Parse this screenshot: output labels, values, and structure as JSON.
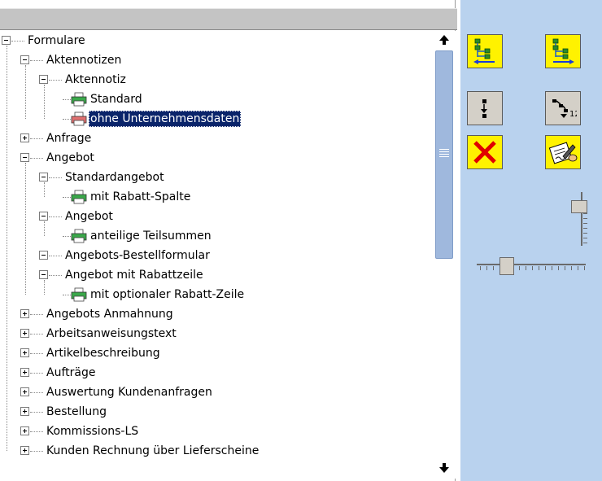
{
  "tree": {
    "rows": [
      {
        "label": "Formulare",
        "level": 0,
        "toggle": "minus",
        "icon": "none"
      },
      {
        "label": "Aktennotizen",
        "level": 1,
        "toggle": "minus",
        "icon": "none"
      },
      {
        "label": "Aktennotiz",
        "level": 2,
        "toggle": "minus",
        "icon": "none"
      },
      {
        "label": "Standard",
        "level": 3,
        "toggle": "none",
        "icon": "printer-green"
      },
      {
        "label": "ohne Unternehmensdaten",
        "level": 3,
        "toggle": "none",
        "icon": "printer-red",
        "selected": true
      },
      {
        "label": "Anfrage",
        "level": 1,
        "toggle": "plus",
        "icon": "none"
      },
      {
        "label": "Angebot",
        "level": 1,
        "toggle": "minus",
        "icon": "none"
      },
      {
        "label": "Standardangebot",
        "level": 2,
        "toggle": "minus",
        "icon": "none"
      },
      {
        "label": "mit Rabatt-Spalte",
        "level": 3,
        "toggle": "none",
        "icon": "printer-green"
      },
      {
        "label": "Angebot",
        "level": 2,
        "toggle": "minus",
        "icon": "none"
      },
      {
        "label": "anteilige Teilsummen",
        "level": 3,
        "toggle": "none",
        "icon": "printer-green"
      },
      {
        "label": "Angebots-Bestellformular",
        "level": 2,
        "toggle": "minus",
        "icon": "none"
      },
      {
        "label": "Angebot mit Rabattzeile",
        "level": 2,
        "toggle": "minus",
        "icon": "none"
      },
      {
        "label": "mit optionaler Rabatt-Zeile",
        "level": 3,
        "toggle": "none",
        "icon": "printer-green"
      },
      {
        "label": "Angebots Anmahnung",
        "level": 1,
        "toggle": "plus",
        "icon": "none"
      },
      {
        "label": "Arbeitsanweisungstext",
        "level": 1,
        "toggle": "plus",
        "icon": "none"
      },
      {
        "label": "Artikelbeschreibung",
        "level": 1,
        "toggle": "plus",
        "icon": "none"
      },
      {
        "label": "Aufträge",
        "level": 1,
        "toggle": "plus",
        "icon": "none"
      },
      {
        "label": "Auswertung Kundenanfragen",
        "level": 1,
        "toggle": "plus",
        "icon": "none"
      },
      {
        "label": "Bestellung",
        "level": 1,
        "toggle": "plus",
        "icon": "none"
      },
      {
        "label": "Kommissions-LS",
        "level": 1,
        "toggle": "plus",
        "icon": "none"
      },
      {
        "label": "Kunden Rechnung über Lieferscheine",
        "level": 1,
        "toggle": "plus",
        "icon": "none"
      }
    ]
  },
  "scrollbar": {
    "up_icon": "arrow-up-icon",
    "down_icon": "arrow-down-icon",
    "position": 0.0
  },
  "toolbar": {
    "buttons": [
      {
        "name": "tree-move-left-button",
        "icon": "tree-arrow-left-icon",
        "color": "yellow"
      },
      {
        "name": "tree-move-right-button",
        "icon": "tree-arrow-right-icon",
        "color": "yellow"
      },
      {
        "name": "sort-button",
        "icon": "sort-icon",
        "color": "gray"
      },
      {
        "name": "sort-tree-button",
        "icon": "sort-tree-icon",
        "color": "gray"
      },
      {
        "name": "delete-button",
        "icon": "red-x-icon",
        "color": "yellow"
      },
      {
        "name": "edit-button",
        "icon": "pen-signature-icon",
        "color": "yellow"
      }
    ],
    "vertical_slider_level": 0.2,
    "horizontal_slider_level": 0.25
  },
  "colors": {
    "selection": "#0a246a",
    "tool_panel": "#b9d2ee",
    "yellow_button": "#fff200",
    "scroll_thumb": "#9fb8dd"
  }
}
